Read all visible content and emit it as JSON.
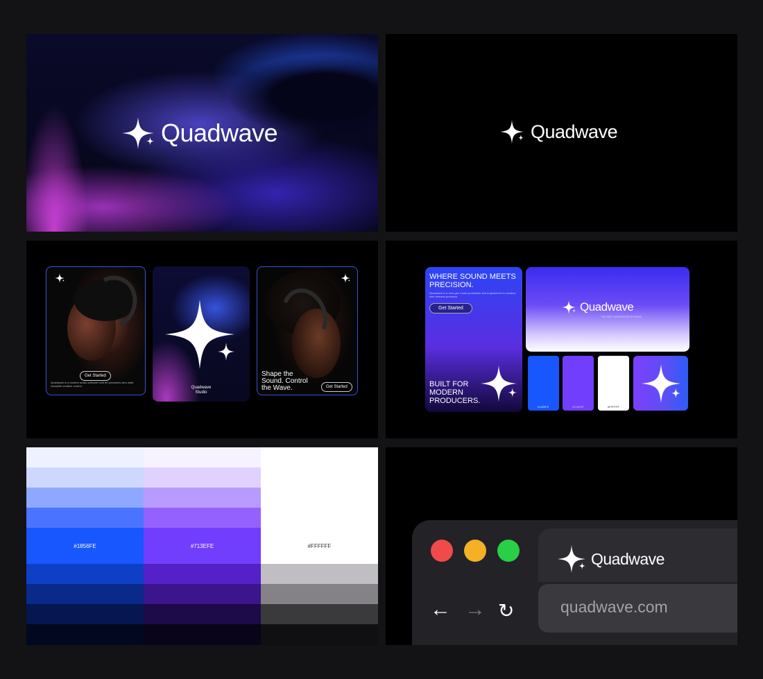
{
  "brand": {
    "name": "Quadwave"
  },
  "poster_cards": {
    "card1_button": "Get Started",
    "card1_text": "Quadwave is a modern audio software built for producers who want complete creative control.",
    "card2_title": "Quadwave",
    "card2_sub": "Studio",
    "card3_headline": "Shape the Sound. Control the Wave.",
    "card3_button": "Get Started"
  },
  "mockups": {
    "left_headline": "WHERE SOUND MEETS PRECISION.",
    "left_body": "Quadwave is a next-gen music production tool engineered for creators who demand precision.",
    "left_button": "Get Started",
    "left_footer": "BUILT FOR MODERN PRODUCERS.",
    "right_brand": "Quadwave",
    "right_tagline": "THE NEXT GENERATION OF AUDIO",
    "swatches": [
      "#1856FE",
      "#713EFE",
      "#FFFFFF"
    ]
  },
  "palette": {
    "labels": [
      "#1856FE",
      "#713EFE",
      "#FFFFFF"
    ],
    "colors": {
      "blue": [
        "#eef1ff",
        "#ced8ff",
        "#8ea8ff",
        "#4a74ff",
        "#1856fe",
        "#0e3fc7",
        "#0a2a8a",
        "#061650",
        "#020820"
      ],
      "purple": [
        "#f6f2ff",
        "#e0d2ff",
        "#b89bff",
        "#9461ff",
        "#713efe",
        "#5420c8",
        "#3a158c",
        "#1d0a48",
        "#0a0418"
      ],
      "white": [
        "#ffffff",
        "#ffffff",
        "#ffffff",
        "#ffffff",
        "#ffffff",
        "#c0bec2",
        "#848286",
        "#3a393c",
        "#101012"
      ]
    }
  },
  "browser": {
    "tab_title": "Quadwave",
    "url": "quadwave.com",
    "dots": [
      "#f04a4a",
      "#f5b126",
      "#29cf45"
    ]
  }
}
